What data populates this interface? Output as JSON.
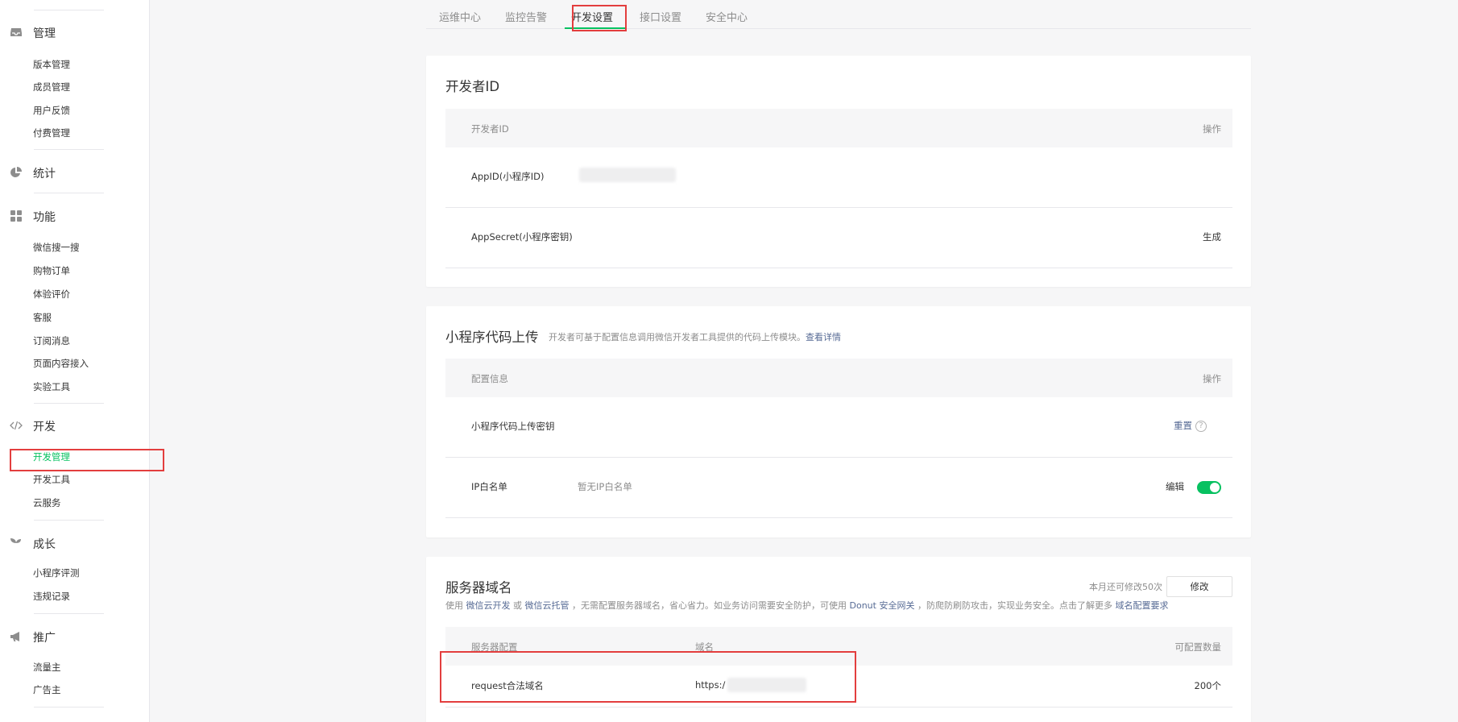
{
  "sidebar": {
    "groups": [
      {
        "title": "管理",
        "icon": "inbox-icon",
        "items": [
          "版本管理",
          "成员管理",
          "用户反馈",
          "付费管理"
        ]
      },
      {
        "title": "统计",
        "icon": "pie-chart-icon",
        "items": []
      },
      {
        "title": "功能",
        "icon": "grid-icon",
        "items": [
          "微信搜一搜",
          "购物订单",
          "体验评价",
          "客服",
          "订阅消息",
          "页面内容接入",
          "实验工具"
        ]
      },
      {
        "title": "开发",
        "icon": "code-icon",
        "items": [
          "开发管理",
          "开发工具",
          "云服务"
        ],
        "active_item": "开发管理"
      },
      {
        "title": "成长",
        "icon": "sprout-icon",
        "items": [
          "小程序评测",
          "违规记录"
        ]
      },
      {
        "title": "推广",
        "icon": "megaphone-icon",
        "items": [
          "流量主",
          "广告主"
        ]
      }
    ]
  },
  "tabs": [
    "运维中心",
    "监控告警",
    "开发设置",
    "接口设置",
    "安全中心"
  ],
  "active_tab": "开发设置",
  "developer_id": {
    "title": "开发者ID",
    "col_left": "开发者ID",
    "col_right": "操作",
    "rows": [
      {
        "label": "AppID(小程序ID)",
        "value_hidden": true,
        "action": ""
      },
      {
        "label": "AppSecret(小程序密钥)",
        "action": "生成"
      }
    ]
  },
  "code_upload": {
    "title": "小程序代码上传",
    "desc": "开发者可基于配置信息调用微信开发者工具提供的代码上传模块。",
    "desc_link": "查看详情",
    "col_left": "配置信息",
    "col_right": "操作",
    "rows": [
      {
        "label": "小程序代码上传密钥",
        "action": "重置",
        "help": "?"
      },
      {
        "label": "IP白名单",
        "value": "暂无IP白名单",
        "action": "编辑",
        "toggle_on": true
      }
    ]
  },
  "server_domain": {
    "title": "服务器域名",
    "quota_text": "本月还可修改50次",
    "modify_button": "修改",
    "desc_parts": [
      "使用",
      "微信云开发",
      "或",
      "微信云托管",
      "，无需配置服务器域名，省心省力。如业务访问需要安全防护，可使用",
      "Donut 安全网关",
      "，防爬防刷防攻击，实现业务安全。点击了解更多",
      "域名配置要求"
    ],
    "col_1": "服务器配置",
    "col_2": "域名",
    "col_3": "可配置数量",
    "rows": [
      {
        "config": "request合法域名",
        "domain": "https:/",
        "count": "200个"
      }
    ]
  },
  "colors": {
    "accent": "#07c160",
    "link": "#576b95",
    "highlight": "#e33e3e"
  }
}
